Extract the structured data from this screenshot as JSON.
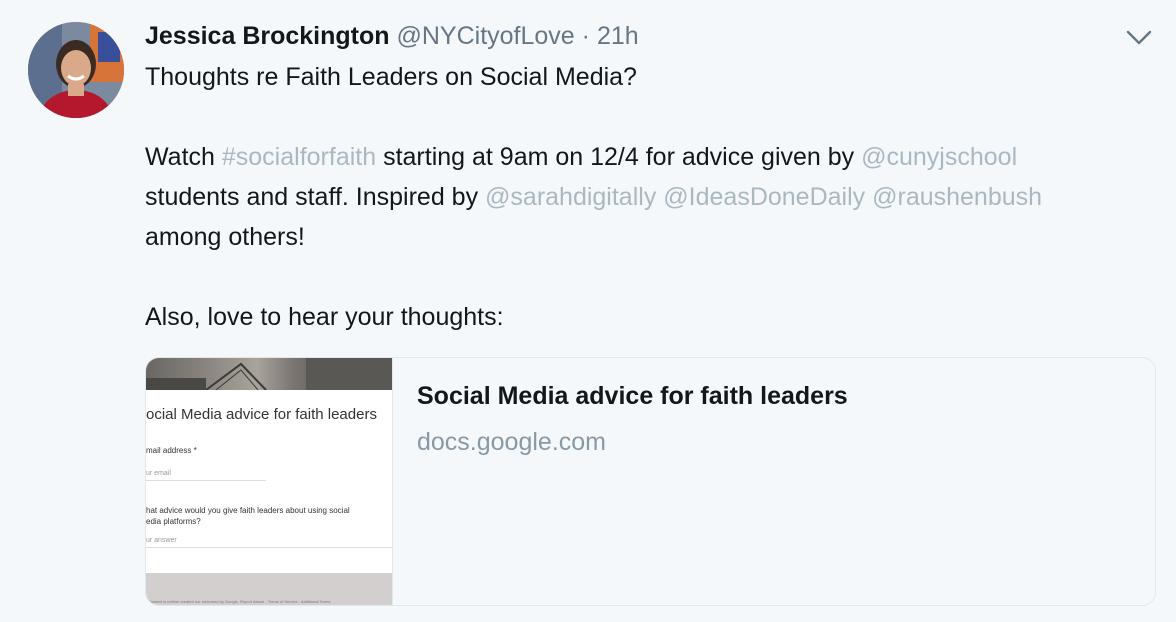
{
  "tweet": {
    "fullname": "Jessica Brockington",
    "username": "@NYCityofLove",
    "separator": "·",
    "time": "21h",
    "line1": "Thoughts re Faith Leaders on Social Media?",
    "line2": {
      "w1": "Watch ",
      "hashtag": "#socialforfaith",
      "w2": " starting at 9am on 12/4 for advice given by ",
      "mention1": "@cunyjschool"
    },
    "line3": {
      "w1": "students and staff. Inspired by ",
      "mention2": "@sarahdigitally",
      "mention3": "@IdeasDoneDaily",
      "mention4": "@raushenbush"
    },
    "line4": "among others!",
    "line5": "Also, love to hear your thoughts:"
  },
  "card": {
    "title": "Social Media advice for faith leaders",
    "domain": "docs.google.com",
    "thumbnail": {
      "form_title": "ocial Media advice for faith leaders",
      "field1_label": "mail address *",
      "field1_hint": "ur email",
      "field2_label_a": "hat advice would you give faith leaders about using social",
      "field2_label_b": "edia platforms?",
      "field2_hint": "ur answer",
      "footer": "Content is neither created nor endorsed by Google. Report Abuse - Terms of Service - Additional Terms"
    }
  },
  "icons": {
    "caret": "chevron-down-icon",
    "avatar": "avatar"
  },
  "colors": {
    "background": "#f5f8fa",
    "text": "#14171a",
    "muted": "#657786",
    "link": "#aab8c2",
    "card_border": "#e1e8ed"
  }
}
